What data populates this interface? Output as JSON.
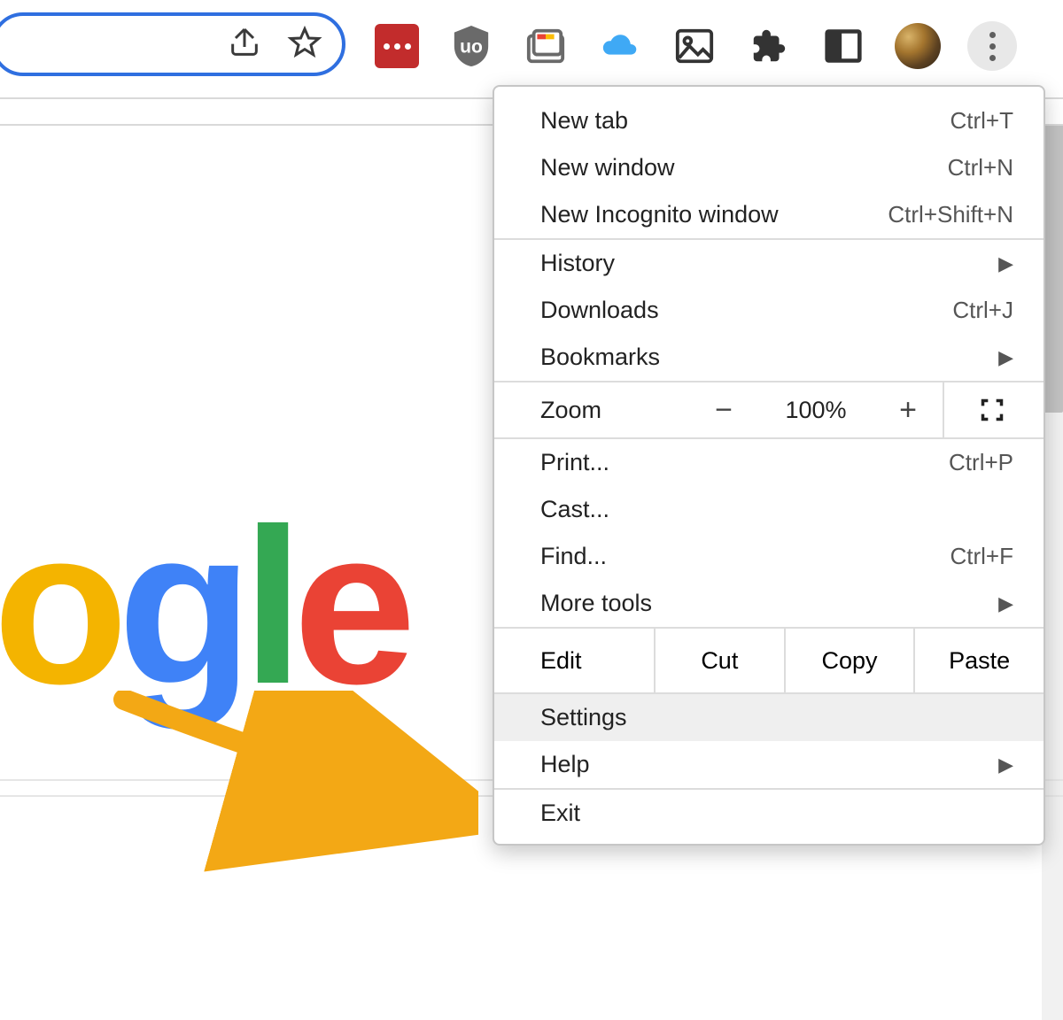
{
  "address_bar": {
    "share_icon": "share",
    "star_icon": "bookmark-star"
  },
  "toolbar_icons": {
    "lastpass": "lastpass",
    "ublock": "ublock-origin",
    "tab_stash": "tab-stash",
    "cloud": "cloud-app",
    "image": "image-tool",
    "extensions": "extensions",
    "side_panel": "side-panel",
    "avatar": "profile-avatar",
    "more": "customize-and-control"
  },
  "menu": {
    "new_tab": {
      "label": "New tab",
      "shortcut": "Ctrl+T"
    },
    "new_window": {
      "label": "New window",
      "shortcut": "Ctrl+N"
    },
    "new_incognito": {
      "label": "New Incognito window",
      "shortcut": "Ctrl+Shift+N"
    },
    "history": {
      "label": "History"
    },
    "downloads": {
      "label": "Downloads",
      "shortcut": "Ctrl+J"
    },
    "bookmarks": {
      "label": "Bookmarks"
    },
    "zoom": {
      "label": "Zoom",
      "value": "100%",
      "minus": "−",
      "plus": "+"
    },
    "print": {
      "label": "Print...",
      "shortcut": "Ctrl+P"
    },
    "cast": {
      "label": "Cast..."
    },
    "find": {
      "label": "Find...",
      "shortcut": "Ctrl+F"
    },
    "more_tools": {
      "label": "More tools"
    },
    "edit": {
      "label": "Edit",
      "cut": "Cut",
      "copy": "Copy",
      "paste": "Paste"
    },
    "settings": {
      "label": "Settings"
    },
    "help": {
      "label": "Help"
    },
    "exit": {
      "label": "Exit"
    }
  },
  "google_logo_fragment": {
    "o": "o",
    "g": "g",
    "l": "l",
    "e": "e"
  },
  "annotation": {
    "target": "Settings"
  }
}
